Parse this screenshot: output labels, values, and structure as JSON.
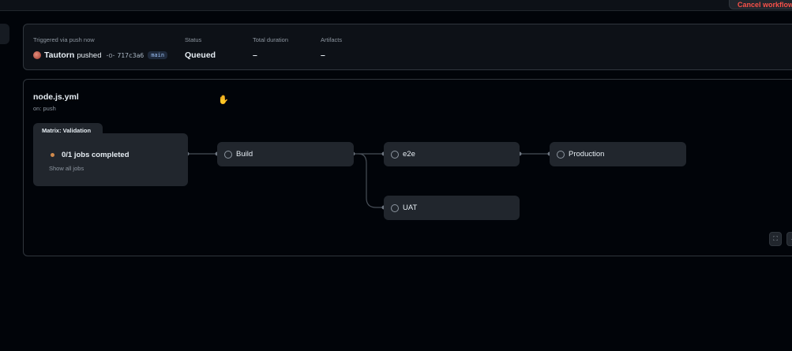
{
  "header": {
    "cancel_label": "Cancel workflow"
  },
  "summary": {
    "trigger_label": "Triggered via push now",
    "user": "Tautorn",
    "action": "pushed",
    "commit": "717c3a6",
    "branch": "main",
    "status_label": "Status",
    "status_value": "Queued",
    "duration_label": "Total duration",
    "duration_value": "–",
    "artifacts_label": "Artifacts",
    "artifacts_value": "–"
  },
  "workflow": {
    "name": "node.js.yml",
    "trigger": "on: push",
    "matrix": {
      "title": "Matrix: Validation",
      "status": "0/1 jobs completed",
      "link": "Show all jobs"
    },
    "jobs": [
      {
        "label": "Build"
      },
      {
        "label": "e2e"
      },
      {
        "label": "Production"
      },
      {
        "label": "UAT"
      }
    ]
  },
  "colors": {
    "background": "#010409",
    "panel": "#0d1117",
    "node": "#21262d",
    "border": "#30363d",
    "queued_dot": "#d18a4c",
    "danger": "#f85149"
  }
}
